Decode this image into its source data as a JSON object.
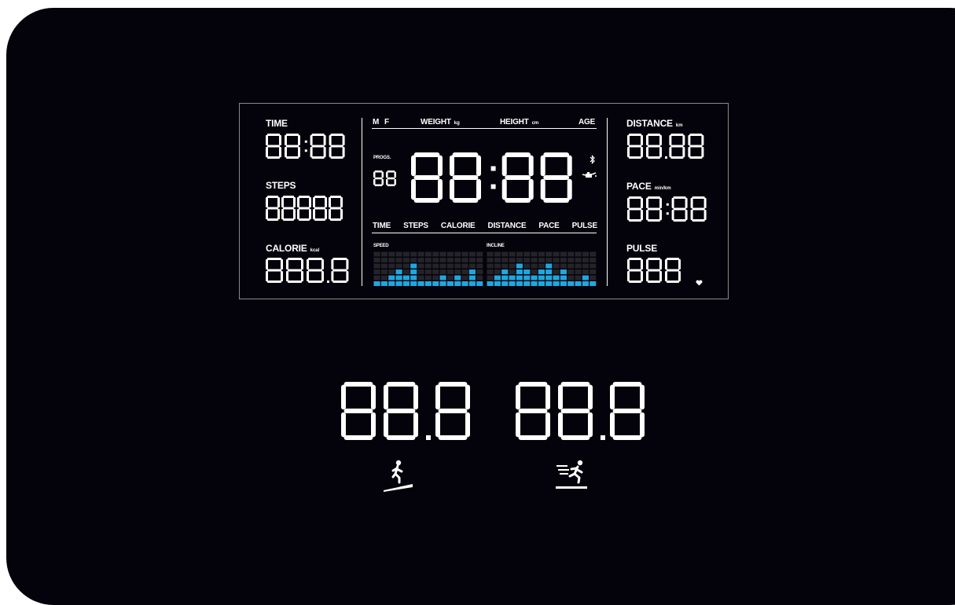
{
  "lcd": {
    "left": {
      "time_label": "TIME",
      "time_value": "88:88",
      "steps_label": "STEPS",
      "steps_value": "88888",
      "calorie_label": "CALORIE",
      "calorie_unit": "kcal",
      "calorie_value": "888.8"
    },
    "center": {
      "m_label": "M",
      "f_label": "F",
      "weight_label": "WEIGHT",
      "weight_unit": "kg",
      "height_label": "HEIGHT",
      "height_unit": "cm",
      "age_label": "AGE",
      "progs_label": "PROGS.",
      "progs_value": "88",
      "main_value": "88:88",
      "modes": [
        "TIME",
        "STEPS",
        "CALORIE",
        "DISTANCE",
        "PACE",
        "PULSE"
      ],
      "speed_label": "SPEED",
      "incline_label": "INCLINE",
      "speed_levels": [
        1,
        1,
        2,
        3,
        2,
        4,
        1,
        1,
        1,
        2,
        1,
        2,
        1,
        3,
        1
      ],
      "incline_levels": [
        1,
        2,
        3,
        2,
        4,
        3,
        2,
        3,
        4,
        2,
        3,
        1,
        1,
        2,
        1
      ],
      "bar_accent": "#1ea8e0"
    },
    "right": {
      "distance_label": "DISTANCE",
      "distance_unit": "km",
      "distance_value": "88.88",
      "pace_label": "PACE",
      "pace_unit": "min/km",
      "pace_value": "88:88",
      "pulse_label": "PULSE",
      "pulse_value": "888"
    }
  },
  "lower": {
    "incline_value": "88.8",
    "speed_value": "88.8"
  },
  "icons": [
    "bluetooth-icon",
    "pump-icon",
    "heart-icon",
    "incline-walker-icon",
    "runner-icon"
  ]
}
